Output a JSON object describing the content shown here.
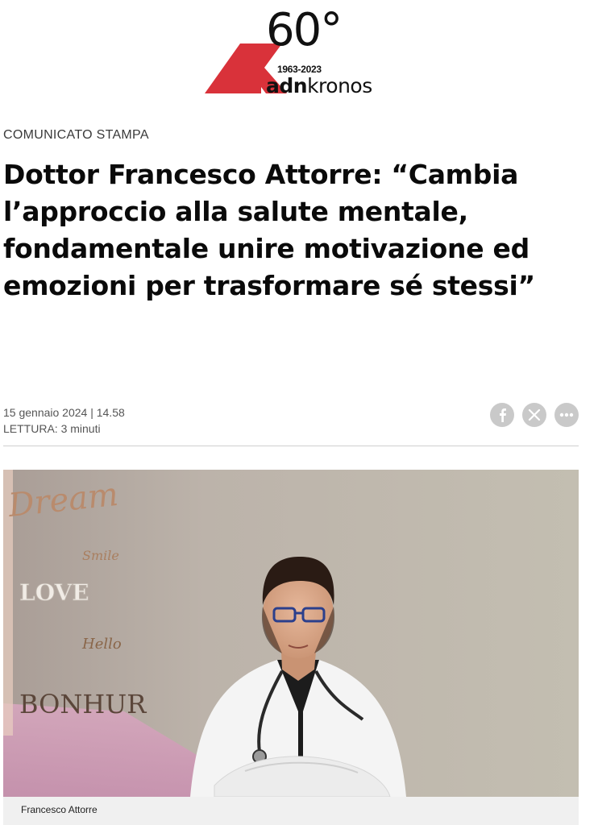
{
  "header": {
    "anniversary_number": "60°",
    "anniversary_years": "1963-2023",
    "brand_bold": "adn",
    "brand_light": "kronos",
    "logo_color": "#d9323a"
  },
  "article": {
    "kicker": "COMUNICATO STAMPA",
    "title": "Dottor Francesco Attorre: “Cambia l’approccio alla salute mentale, fondamentale unire motivazione ed emozioni per trasformare sé stessi”",
    "date": "15 gennaio 2024 | 14.58",
    "reading_time": "LETTURA: 3 minuti"
  },
  "share": {
    "icons": [
      "facebook-icon",
      "x-icon",
      "more-icon"
    ],
    "button_color": "#c9c9c9"
  },
  "photo": {
    "wall_words": [
      "Dream",
      "Smile",
      "LOVE",
      "Hello",
      "BONHUR"
    ],
    "caption": "Francesco Attorre"
  }
}
